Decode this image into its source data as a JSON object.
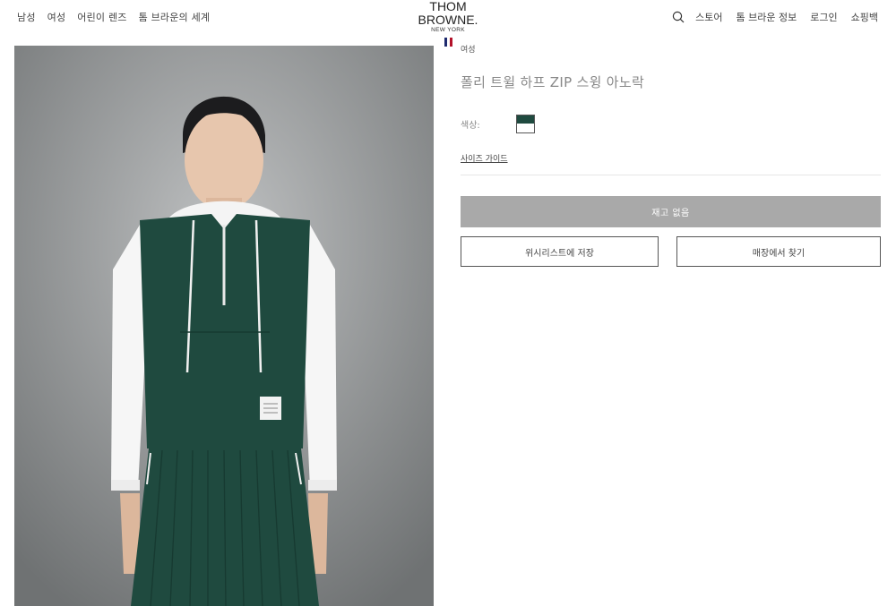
{
  "nav": {
    "left_items": [
      "남성",
      "여성",
      "어린이 렌즈",
      "톰 브라운의 세계"
    ],
    "right_items": [
      "스토어",
      "톰 브라운 정보",
      "로그인",
      "쇼핑백"
    ],
    "search_icon": "search-icon"
  },
  "brand": {
    "name": "THOM BROWNE.",
    "sub": "NEW YORK",
    "stripe_colors": [
      "#1e2a6e",
      "#ffffff",
      "#b3122a"
    ]
  },
  "product": {
    "category": "여성",
    "title": "폴리 트윌 하프 ZIP 스윙 아노락",
    "color_label": "색상:",
    "swatch_color": "#1f4a3f",
    "size_guide": "사이즈 가이드",
    "soldout_label": "재고 없음",
    "wishlist_label": "위시리스트에 저장",
    "find_store_label": "매장에서 찾기"
  },
  "colors": {
    "soldout_bg": "#a9a9a9",
    "garment_green": "#1f4a3f"
  }
}
